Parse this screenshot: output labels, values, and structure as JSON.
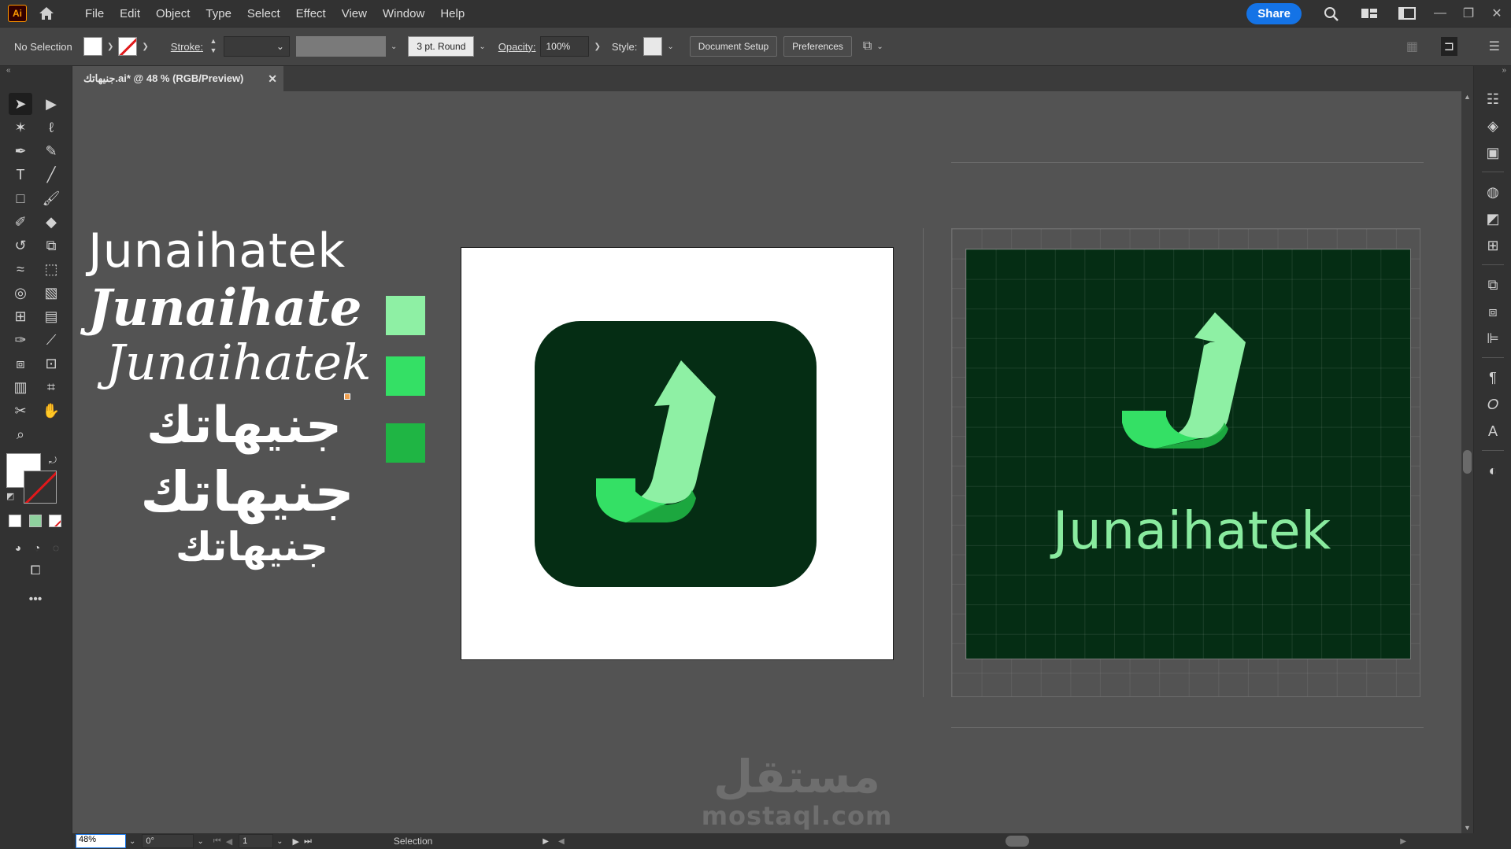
{
  "app": {
    "logo": "Ai"
  },
  "menu": [
    "File",
    "Edit",
    "Object",
    "Type",
    "Select",
    "Effect",
    "View",
    "Window",
    "Help"
  ],
  "header": {
    "share_label": "Share"
  },
  "control": {
    "selection_label": "No Selection",
    "stroke_label": "Stroke:",
    "brush_label": "3 pt. Round",
    "opacity_label": "Opacity:",
    "opacity_value": "100%",
    "style_label": "Style:",
    "doc_setup_label": "Document Setup",
    "preferences_label": "Preferences"
  },
  "document": {
    "tab_title": "جنيهاتك.ai* @ 48 % (RGB/Preview)"
  },
  "canvas": {
    "font_samples": [
      "Junaihatek",
      "Junaihate",
      "Junaihatek"
    ],
    "arabic_samples": [
      "جنيهاتك",
      "جنيهاتك",
      "جنيهاتك"
    ],
    "swatch_colors": [
      "#8ef0a4",
      "#34e065",
      "#1fb544"
    ],
    "icon_bg": "#052d14",
    "grid_logo_text": "Junaihatek",
    "watermark_ar": "مستقل",
    "watermark_en": "mostaql.com"
  },
  "status": {
    "zoom": "48%",
    "rotation": "0°",
    "artboard": "1",
    "tool": "Selection"
  }
}
